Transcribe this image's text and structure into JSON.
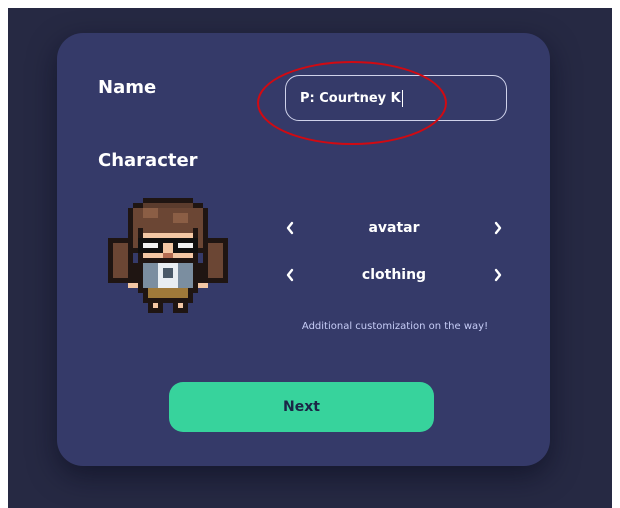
{
  "form": {
    "name_label": "Name",
    "name_value": "P: Courtney K",
    "character_label": "Character"
  },
  "selectors": [
    {
      "label": "avatar",
      "prev_icon": "chevron-left-icon",
      "next_icon": "chevron-right-icon"
    },
    {
      "label": "clothing",
      "prev_icon": "chevron-left-icon",
      "next_icon": "chevron-right-icon"
    }
  ],
  "note": "Additional customization on the way!",
  "actions": {
    "next_label": "Next"
  },
  "colors": {
    "page_background": "#262943",
    "card": "#353a69",
    "accent_button": "#37d39c",
    "annotation_circle": "#d10a12",
    "note_text": "#c7cdf7"
  }
}
